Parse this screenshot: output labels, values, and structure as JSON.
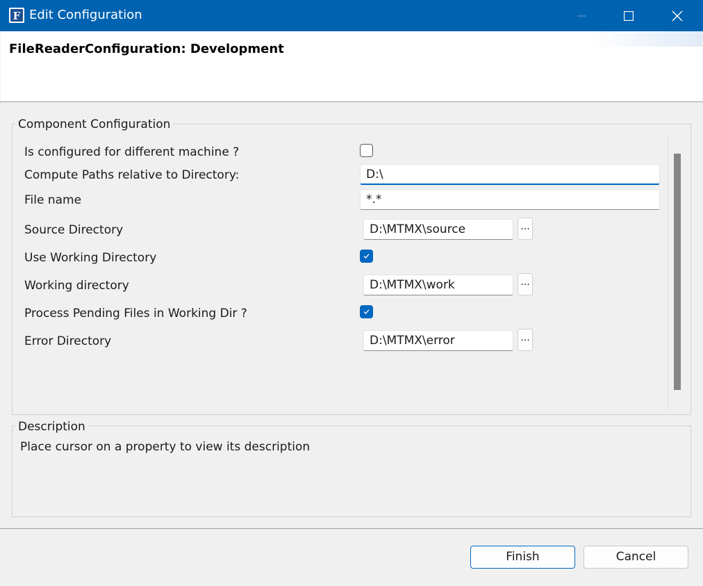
{
  "window": {
    "title": "Edit Configuration",
    "icon": "app-icon-F",
    "icon_letter": "F",
    "accent_color": "#0063b1"
  },
  "header": {
    "title": "FileReaderConfiguration: Development"
  },
  "component_config": {
    "legend": "Component Configuration",
    "properties": {
      "different_machine": {
        "label": "Is configured for different machine ?",
        "checked": false
      },
      "compute_paths": {
        "label": "Compute Paths relative to Directory:",
        "value": "D:\\"
      },
      "file_name": {
        "label": "File name",
        "value": "*.*"
      },
      "source_directory": {
        "label": "Source Directory",
        "value": "D:\\MTMX\\source",
        "browse_label": "..."
      },
      "use_working_directory": {
        "label": "Use Working Directory",
        "checked": true
      },
      "working_directory": {
        "label": "Working directory",
        "value": "D:\\MTMX\\work",
        "browse_label": "..."
      },
      "process_pending": {
        "label": "Process Pending Files in Working Dir ?",
        "checked": true
      },
      "error_directory": {
        "label": "Error Directory",
        "value": "D:\\MTMX\\error",
        "browse_label": "..."
      }
    }
  },
  "description": {
    "legend": "Description",
    "text": "Place cursor on a property to view its description"
  },
  "buttons": {
    "finish": "Finish",
    "cancel": "Cancel"
  },
  "colors": {
    "checkbox_checked": "#0067c0",
    "focus_underline": "#0067c0"
  }
}
